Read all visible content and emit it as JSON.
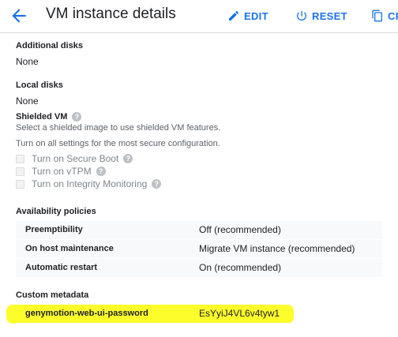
{
  "header": {
    "title": "VM instance details",
    "actions": {
      "edit": "EDIT",
      "reset": "RESET",
      "copy": "CR"
    },
    "accent_color": "#1a73e8"
  },
  "additional_disks": {
    "label": "Additional disks",
    "value": "None"
  },
  "local_disks": {
    "label": "Local disks",
    "value": "None"
  },
  "shielded_vm": {
    "label": "Shielded VM",
    "description": "Select a shielded image to use shielded VM features.",
    "hint": "Turn on all settings for the most secure configuration.",
    "options": [
      {
        "label": "Turn on Secure Boot",
        "checked": false,
        "disabled": true
      },
      {
        "label": "Turn on vTPM",
        "checked": false,
        "disabled": true
      },
      {
        "label": "Turn on Integrity Monitoring",
        "checked": false,
        "disabled": true
      }
    ]
  },
  "availability": {
    "label": "Availability policies",
    "rows": [
      {
        "key": "Preemptibility",
        "value": "Off (recommended)"
      },
      {
        "key": "On host maintenance",
        "value": "Migrate VM instance (recommended)"
      },
      {
        "key": "Automatic restart",
        "value": "On (recommended)"
      }
    ]
  },
  "custom_metadata": {
    "label": "Custom metadata",
    "rows": [
      {
        "key": "genymotion-web-ui-password",
        "value": "EsYyiJ4VL6v4tyw1"
      }
    ],
    "highlight_color": "#fdfd2b"
  }
}
